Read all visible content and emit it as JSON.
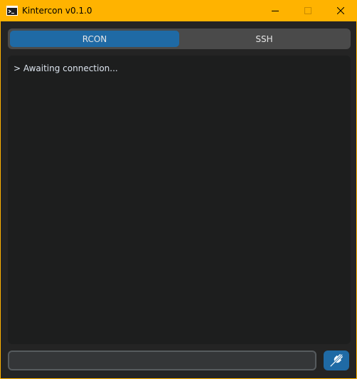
{
  "window": {
    "title": "Kintercon v0.1.0"
  },
  "tabs": [
    {
      "label": "RCON",
      "active": true
    },
    {
      "label": "SSH",
      "active": false
    }
  ],
  "console": {
    "lines": [
      "> Awaiting connection..."
    ]
  },
  "command": {
    "value": "",
    "placeholder": ""
  },
  "icons": {
    "app": "terminal-icon",
    "minimize": "minimize-icon",
    "maximize": "maximize-icon",
    "close": "close-icon",
    "connect": "plug-icon"
  },
  "colors": {
    "titlebar": "#ffb300",
    "accent": "#1f6aa5",
    "background": "#242424",
    "console_bg": "#1d1e1e"
  }
}
